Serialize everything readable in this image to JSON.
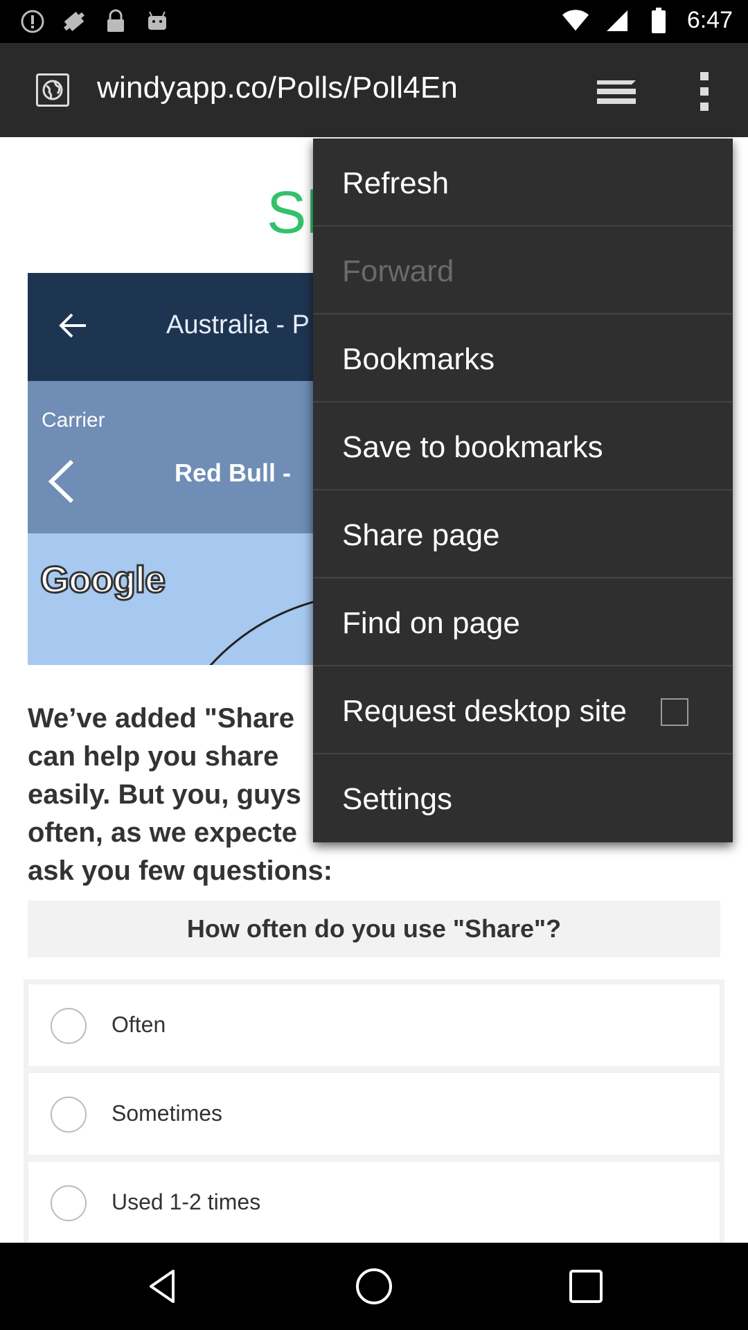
{
  "status_bar": {
    "time": "6:47",
    "icons": [
      "alert-icon",
      "fake-gps-icon",
      "lock-icon",
      "android-icon",
      "wifi-icon",
      "signal-icon",
      "battery-icon"
    ]
  },
  "toolbar": {
    "url": "windyapp.co/Polls/Poll4En",
    "icons": [
      "site-globe-icon",
      "tabs-icon",
      "overflow-menu-icon"
    ]
  },
  "page": {
    "title_partial": "Sl",
    "screenshot": {
      "header_title": "Australia - P",
      "carrier": "Carrier",
      "event_title": "Red Bull -",
      "map_logo": "Google"
    },
    "paragraph_lines": [
      "We’ve added \"Share",
      "can help you share",
      "easily. But you, guys",
      "often, as we expecte",
      "ask you few questions:"
    ],
    "question": "How often do you use \"Share\"?",
    "options": [
      {
        "label": "Often"
      },
      {
        "label": "Sometimes"
      },
      {
        "label": "Used 1-2 times"
      }
    ]
  },
  "menu": {
    "items": [
      {
        "label": "Refresh",
        "disabled": false
      },
      {
        "label": "Forward",
        "disabled": true
      },
      {
        "label": "Bookmarks",
        "disabled": false
      },
      {
        "label": "Save to bookmarks",
        "disabled": false
      },
      {
        "label": "Share page",
        "disabled": false
      },
      {
        "label": "Find on page",
        "disabled": false
      },
      {
        "label": "Request desktop site",
        "disabled": false,
        "checkbox": true,
        "checked": false
      },
      {
        "label": "Settings",
        "disabled": false
      }
    ]
  },
  "colors": {
    "accent_green": "#33c26b",
    "toolbar_bg": "#2a2a2a",
    "menu_bg": "#2f2f2f"
  },
  "navbar": {
    "icons": [
      "back-icon",
      "home-icon",
      "recent-apps-icon"
    ]
  }
}
